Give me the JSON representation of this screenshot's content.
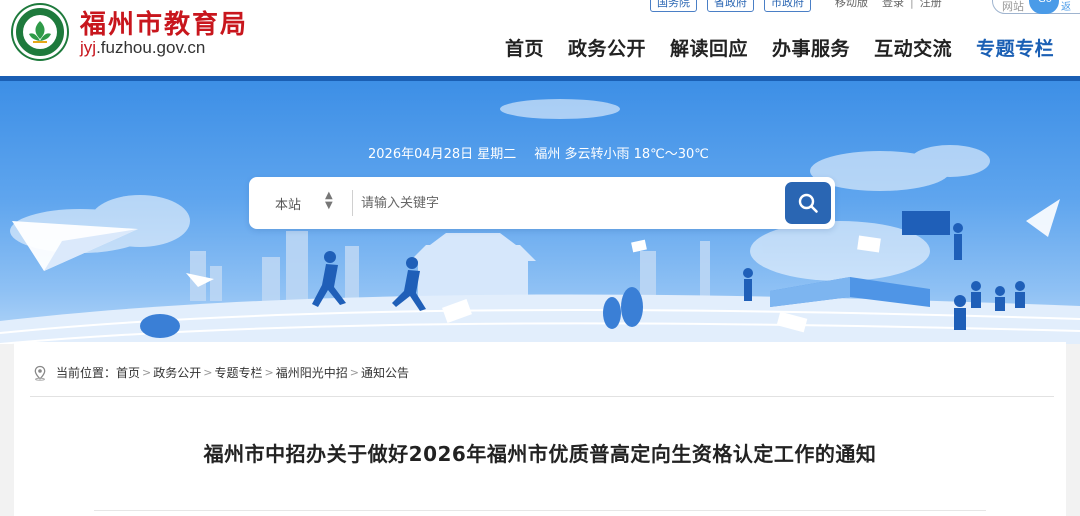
{
  "header": {
    "site_name": "福州市教育局",
    "domain_highlight": "jyj",
    "domain_rest": ".fuzhou.gov.cn",
    "top_pills": [
      "国务院",
      "省政府",
      "市政府"
    ],
    "top_links": [
      "移动版",
      "登录",
      "注册"
    ],
    "top_search": {
      "placeholder": "网站",
      "button": "Go",
      "tail": "返"
    }
  },
  "nav": {
    "items": [
      "首页",
      "政务公开",
      "解读回应",
      "办事服务",
      "互动交流",
      "专题专栏"
    ],
    "active": "专题专栏"
  },
  "banner": {
    "date": "2026年04月28日 星期二",
    "weather": "福州 多云转小雨 18℃～30℃"
  },
  "search": {
    "scope": "本站",
    "placeholder": "请输入关键字"
  },
  "breadcrumb": {
    "label": "当前位置：",
    "items": [
      "首页",
      "政务公开",
      "专题专栏",
      "福州阳光中招",
      "通知公告"
    ]
  },
  "article": {
    "title": "福州市中招办关于做好2026年福州市优质普高定向生资格认定工作的通知"
  },
  "colors": {
    "brand_red": "#c8161d",
    "brand_blue": "#1a5fb4",
    "accent_blue": "#2a66b3",
    "logo_green": "#1e7a3c"
  },
  "icons": [
    "emblem-logo",
    "search-icon",
    "location-icon",
    "chevron-updown-icon"
  ]
}
